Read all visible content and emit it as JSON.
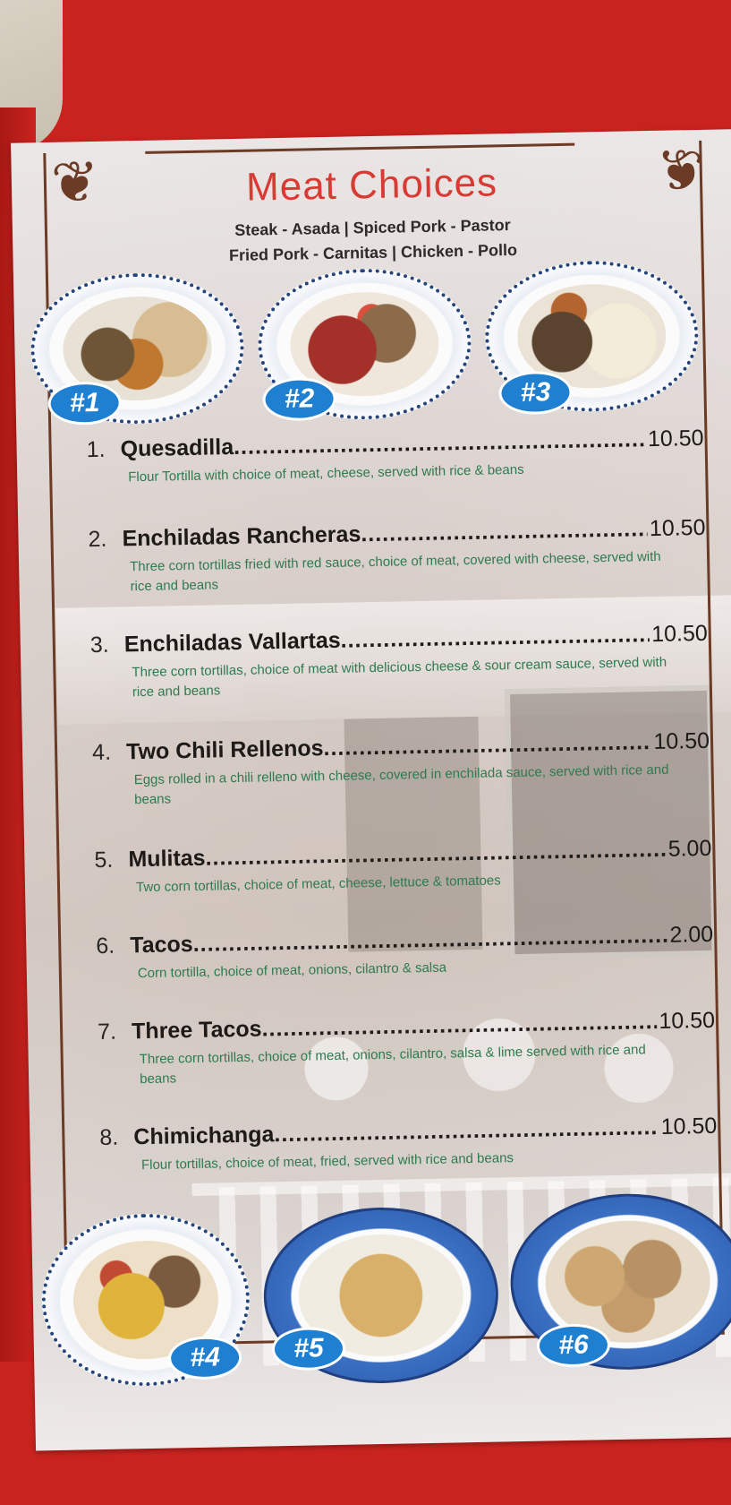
{
  "menu_card": {
    "title": "Meat Choices",
    "meat_choices_line1": "Steak - Asada   |   Spiced Pork - Pastor",
    "meat_choices_line2": "Fried Pork - Carnitas   |   Chicken - Pollo",
    "plate_badges": [
      "#1",
      "#2",
      "#3",
      "#4",
      "#5",
      "#6"
    ],
    "items": [
      {
        "number": "1.",
        "name": "Quesadilla",
        "price": "10.50",
        "description": "Flour Tortilla with choice of meat, cheese, served with rice & beans"
      },
      {
        "number": "2.",
        "name": "Enchiladas Rancheras",
        "price": "10.50",
        "description": "Three corn tortillas fried with red sauce, choice of meat, covered with cheese, served with rice and beans"
      },
      {
        "number": "3.",
        "name": "Enchiladas Vallartas",
        "price": "10.50",
        "description": "Three corn tortillas, choice of meat with delicious cheese & sour cream sauce, served with rice and beans"
      },
      {
        "number": "4.",
        "name": "Two Chili Rellenos",
        "price": "10.50",
        "description": "Eggs rolled in a chili relleno with cheese, covered in enchilada sauce, served with rice and beans"
      },
      {
        "number": "5.",
        "name": "Mulitas",
        "price": "5.00",
        "description": "Two corn tortillas, choice of meat, cheese, lettuce & tomatoes"
      },
      {
        "number": "6.",
        "name": "Tacos",
        "price": "2.00",
        "description": "Corn tortilla, choice of meat, onions, cilantro & salsa"
      },
      {
        "number": "7.",
        "name": "Three Tacos",
        "price": "10.50",
        "description": "Three corn tortillas, choice of meat, onions, cilantro, salsa & lime served with rice and beans"
      },
      {
        "number": "8.",
        "name": "Chimichanga",
        "price": "10.50",
        "description": "Flour tortillas, choice of meat, fried, served with rice and beans"
      }
    ]
  },
  "colors": {
    "tablecloth": "#c9231f",
    "title_red": "#d93a33",
    "description_green": "#2f7a4f",
    "badge_blue": "#1f7fd1",
    "frame_brown": "#6b3b26"
  }
}
